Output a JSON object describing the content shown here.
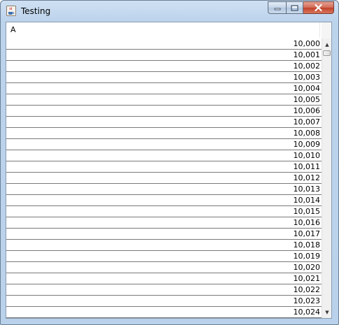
{
  "window": {
    "title": "Testing",
    "icon": "java-cup-icon",
    "buttons": {
      "minimize": "minimize-icon",
      "maximize": "maximize-icon",
      "close": "close-icon"
    }
  },
  "table": {
    "columns": [
      "A"
    ],
    "rows": [
      "10,000",
      "10,001",
      "10,002",
      "10,003",
      "10,004",
      "10,005",
      "10,006",
      "10,007",
      "10,008",
      "10,009",
      "10,010",
      "10,011",
      "10,012",
      "10,013",
      "10,014",
      "10,015",
      "10,016",
      "10,017",
      "10,018",
      "10,019",
      "10,020",
      "10,021",
      "10,022",
      "10,023",
      "10,024"
    ]
  },
  "scrollbar": {
    "up_arrow": "▲",
    "down_arrow": "▼",
    "position": 0.0
  }
}
